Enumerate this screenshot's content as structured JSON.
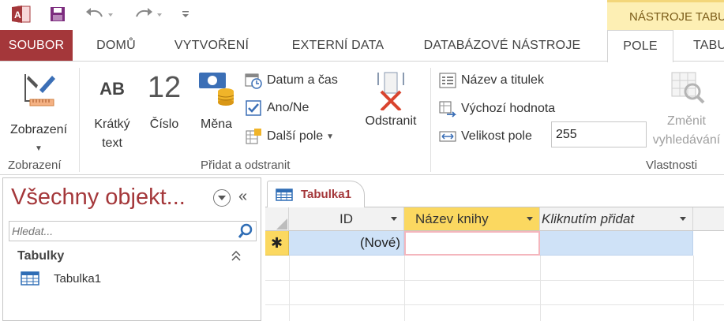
{
  "titlebar": {
    "context_label": "NÁSTROJE TABULKY",
    "icons": [
      "access-logo-icon",
      "save-icon",
      "undo-icon",
      "redo-icon",
      "customize-qat-icon"
    ]
  },
  "tabs": [
    {
      "label": "SOUBOR"
    },
    {
      "label": "DOMŮ"
    },
    {
      "label": "VYTVOŘENÍ"
    },
    {
      "label": "EXTERNÍ DATA"
    },
    {
      "label": "DATABÁZOVÉ NÁSTROJE"
    },
    {
      "label": "POLE"
    },
    {
      "label": "TABULKA"
    }
  ],
  "ribbon": {
    "groups": {
      "views": "Zobrazení",
      "add_delete": "Přidat a odstranit",
      "properties": "Vlastnosti"
    },
    "view_button": "Zobrazení",
    "short_text": {
      "glyph": "AB",
      "line1": "Krátký",
      "line2": "text"
    },
    "number": {
      "glyph": "12",
      "label": "Číslo"
    },
    "currency": "Měna",
    "date_time": "Datum a čas",
    "yes_no": "Ano/Ne",
    "more_fields": "Další pole",
    "delete": "Odstranit",
    "name_caption": "Název a titulek",
    "default_value": "Výchozí hodnota",
    "field_size_label": "Velikost pole",
    "field_size_value": "255",
    "modify_lookups": {
      "line1": "Změnit",
      "line2": "vyhledávání"
    }
  },
  "nav": {
    "title": "Všechny objekt...",
    "search_placeholder": "Hledat...",
    "group": "Tabulky",
    "items": [
      {
        "label": "Tabulka1"
      }
    ]
  },
  "document": {
    "tab_label": "Tabulka1",
    "columns": [
      {
        "label": "ID"
      },
      {
        "label": "Název knihy"
      },
      {
        "label": "Kliknutím přidat"
      }
    ],
    "new_row_marker": "✱",
    "new_row_id": "(Nové)"
  },
  "colors": {
    "accent": "#a4373a",
    "context_tab": "#fdefb4",
    "selected_header": "#fbd860",
    "new_row": "#cfe2f7"
  }
}
